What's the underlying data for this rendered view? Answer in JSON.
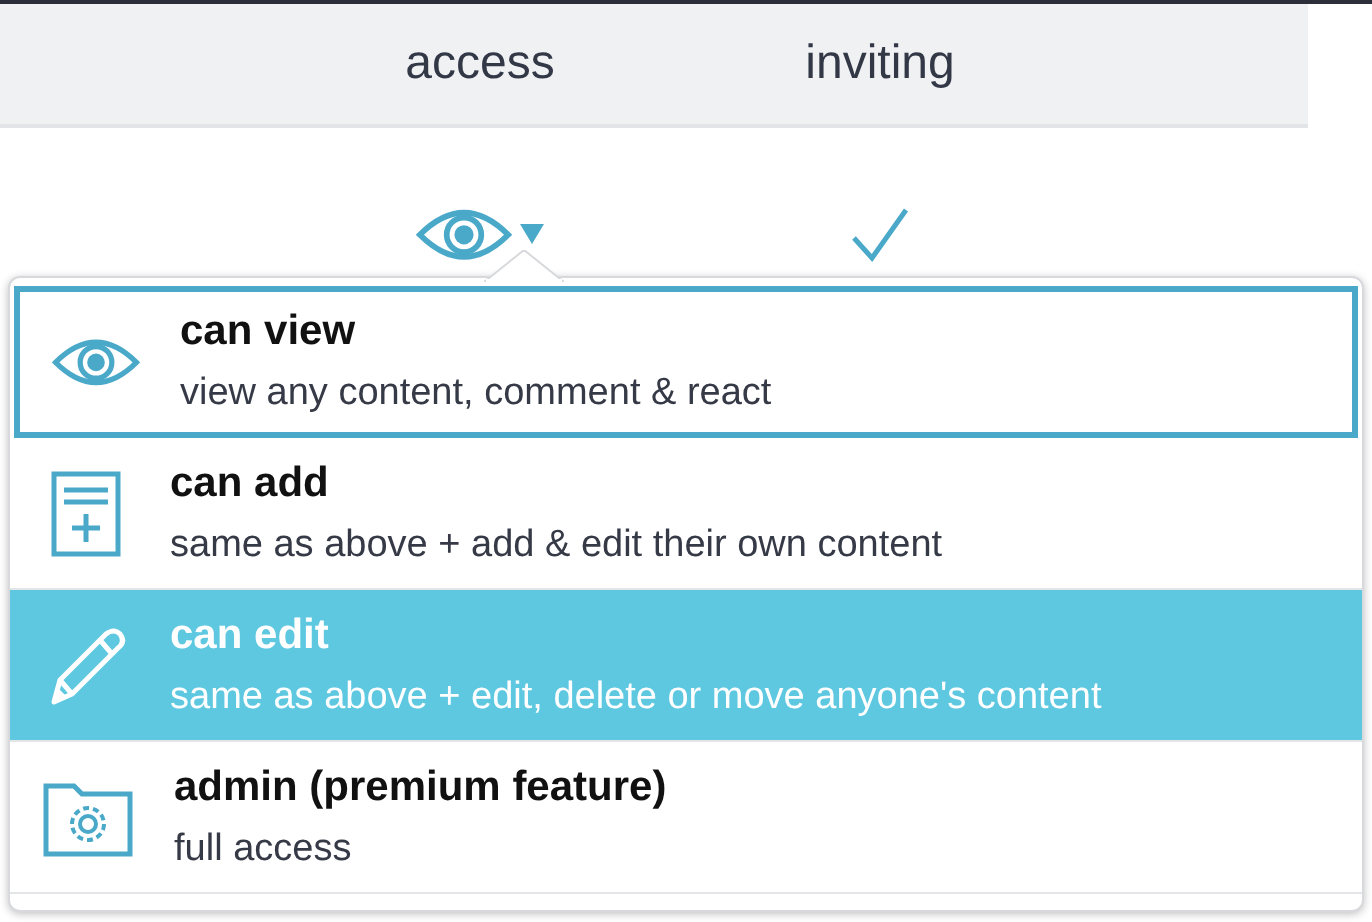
{
  "table": {
    "columns": [
      "access",
      "inviting"
    ],
    "row": {
      "inviting_checked": true
    }
  },
  "menu": {
    "items": [
      {
        "kind": "view",
        "title": "can view",
        "description": "view any content, comment & react",
        "selected": true,
        "highlighted": false
      },
      {
        "kind": "add",
        "title": "can add",
        "description": "same as above + add & edit their own content",
        "selected": false,
        "highlighted": false
      },
      {
        "kind": "edit",
        "title": "can edit",
        "description": "same as above + edit, delete or move anyone's content",
        "selected": false,
        "highlighted": true
      },
      {
        "kind": "admin",
        "title": "admin (premium feature)",
        "description": "full access",
        "selected": false,
        "highlighted": false
      }
    ]
  }
}
